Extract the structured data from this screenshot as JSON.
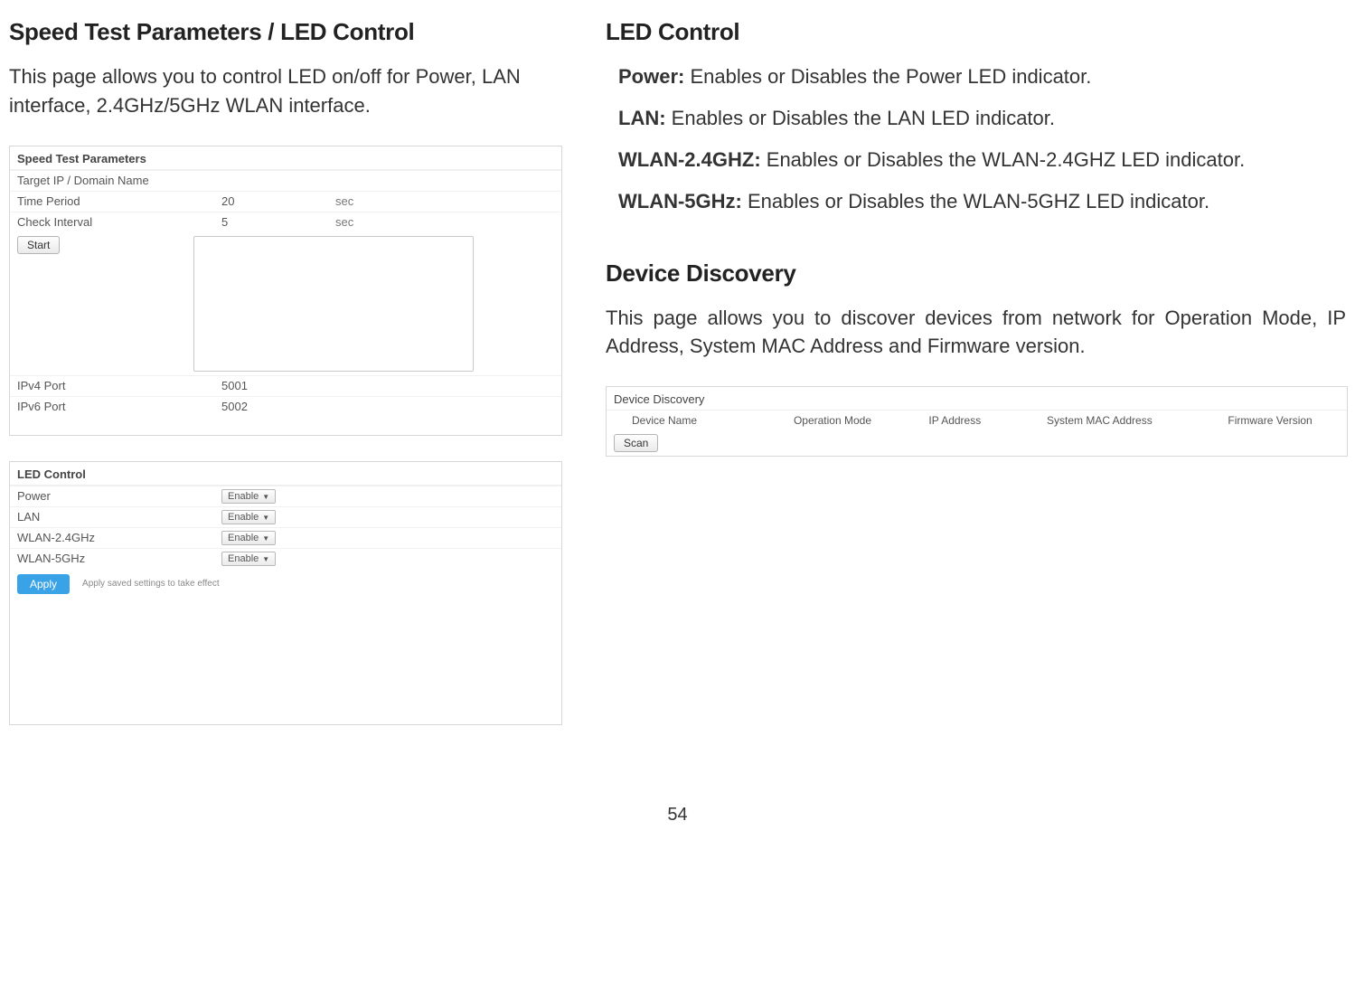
{
  "left": {
    "title": "Speed Test Parameters / LED Control",
    "intro": "This page allows you to control LED on/off for Power, LAN interface, 2.4GHz/5GHz WLAN interface.",
    "speed_panel": {
      "heading": "Speed Test Parameters",
      "rows": {
        "target_label": "Target IP / Domain Name",
        "target_value": "",
        "time_label": "Time Period",
        "time_value": "20",
        "time_unit": "sec",
        "check_label": "Check Interval",
        "check_value": "5",
        "check_unit": "sec",
        "start_btn": "Start",
        "ipv4_label": "IPv4 Port",
        "ipv4_value": "5001",
        "ipv6_label": "IPv6 Port",
        "ipv6_value": "5002"
      }
    },
    "led_panel": {
      "heading": "LED Control",
      "rows": [
        {
          "label": "Power",
          "value": "Enable"
        },
        {
          "label": "LAN",
          "value": "Enable"
        },
        {
          "label": "WLAN-2.4GHz",
          "value": "Enable"
        },
        {
          "label": "WLAN-5GHz",
          "value": "Enable"
        }
      ],
      "apply_btn": "Apply",
      "apply_hint": "Apply saved settings to take effect"
    }
  },
  "right": {
    "title": "LED Control",
    "defs": {
      "power_label": "Power:",
      "power_text": " Enables or Disables the Power LED indicator.",
      "lan_label": "LAN:",
      "lan_text": " Enables or Disables the LAN LED indicator.",
      "wlan24_label": "WLAN-2.4GHZ:",
      "wlan24_text": " Enables or Disables the WLAN-2.4GHZ LED indicator.",
      "wlan5_label": "WLAN-5GHz:",
      "wlan5_text": " Enables or Disables the WLAN-5GHZ LED indicator."
    },
    "dd_title": "Device Discovery",
    "dd_intro": "This page allows you to discover devices from network for Operation Mode, IP Address, System MAC Address and Firmware version.",
    "dd_panel": {
      "heading": "Device Discovery",
      "cols": {
        "c1": "Device Name",
        "c2": "Operation Mode",
        "c3": "IP Address",
        "c4": "System MAC Address",
        "c5": "Firmware Version"
      },
      "scan_btn": "Scan"
    }
  },
  "page_number": "54"
}
